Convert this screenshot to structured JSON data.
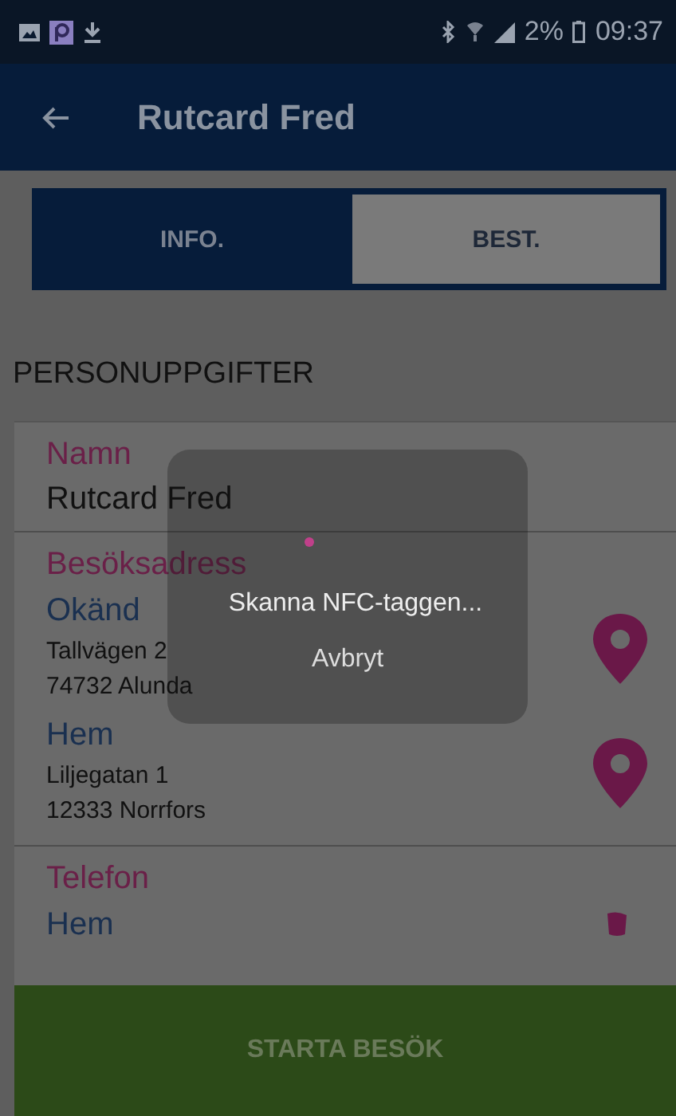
{
  "status_bar": {
    "battery": "2%",
    "time": "09:37"
  },
  "app_bar": {
    "title": "Rutcard Fred"
  },
  "tabs": [
    {
      "label": "INFO.",
      "selected": true
    },
    {
      "label": "BEST.",
      "selected": false
    }
  ],
  "section_title": "PERSONUPPGIFTER",
  "name": {
    "label": "Namn",
    "value": "Rutcard Fred"
  },
  "visit_address": {
    "label": "Besöksadress",
    "addresses": [
      {
        "type": "Okänd",
        "street": "Tallvägen 2",
        "city": "74732 Alunda"
      },
      {
        "type": "Hem",
        "street": "Liljegatan 1",
        "city": "12333 Norrfors"
      }
    ]
  },
  "phone": {
    "label": "Telefon",
    "type": "Hem"
  },
  "dialog": {
    "message": "Skanna NFC-taggen...",
    "cancel": "Avbryt"
  },
  "start_button": "STARTA BESÖK"
}
